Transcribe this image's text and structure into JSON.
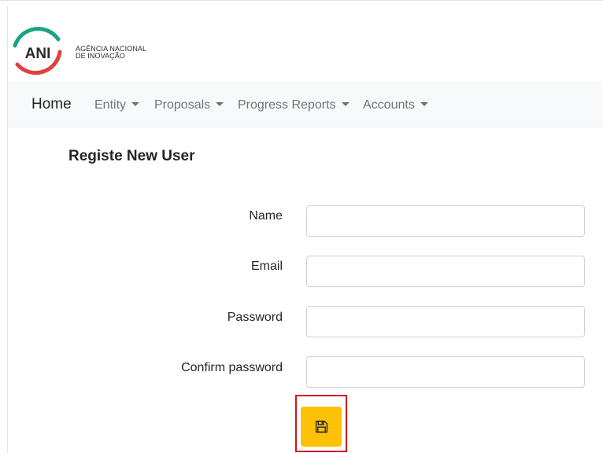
{
  "brand": {
    "logo_text": "ANI",
    "agency_line1": "AGÊNCIA NACIONAL",
    "agency_line2": "DE INOVAÇÃO"
  },
  "nav": {
    "home": "Home",
    "items": [
      "Entity",
      "Proposals",
      "Progress Reports",
      "Accounts"
    ]
  },
  "form": {
    "title": "Registe New User",
    "fields": [
      {
        "label": "Name",
        "value": "",
        "placeholder": ""
      },
      {
        "label": "Email",
        "value": "",
        "placeholder": ""
      },
      {
        "label": "Password",
        "value": "",
        "placeholder": ""
      },
      {
        "label": "Confirm password",
        "value": "",
        "placeholder": ""
      }
    ],
    "submit_icon": "floppy-disk-icon"
  },
  "colors": {
    "accent_button": "#ffc107",
    "highlight_border": "#d0141b",
    "logo_teal": "#1aa386",
    "logo_red": "#e0413f"
  }
}
